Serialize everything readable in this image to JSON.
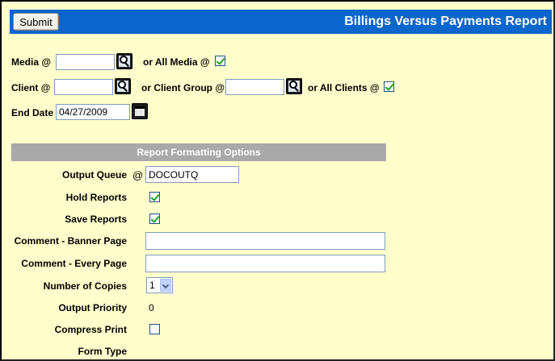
{
  "header": {
    "submit_label": "Submit",
    "title": "Billings Versus Payments Report"
  },
  "filters": {
    "media_label": "Media @",
    "media_value": "",
    "all_media_label": "or All Media @",
    "all_media_checked": true,
    "client_label": "Client @",
    "client_value": "",
    "client_group_label": "or Client Group @",
    "client_group_value": "",
    "all_clients_label": "or All Clients @",
    "all_clients_checked": true,
    "end_date_label": "End Date",
    "end_date_value": "04/27/2009"
  },
  "options": {
    "section_title": "Report Formatting Options",
    "output_queue_label": "Output Queue",
    "output_queue_at": "@",
    "output_queue_value": "DOCOUTQ",
    "hold_reports_label": "Hold Reports",
    "hold_reports_checked": true,
    "save_reports_label": "Save Reports",
    "save_reports_checked": true,
    "comment_banner_label": "Comment - Banner Page",
    "comment_banner_value": "",
    "comment_every_label": "Comment - Every Page",
    "comment_every_value": "",
    "copies_label": "Number of Copies",
    "copies_value": "1",
    "priority_label": "Output Priority",
    "priority_value": "0",
    "compress_label": "Compress Print",
    "compress_checked": false,
    "form_type_label": "Form Type"
  },
  "colors": {
    "page_bg": "#ffffcc",
    "header_bg": "#0a66cc",
    "section_bg": "#a9a9a9"
  }
}
